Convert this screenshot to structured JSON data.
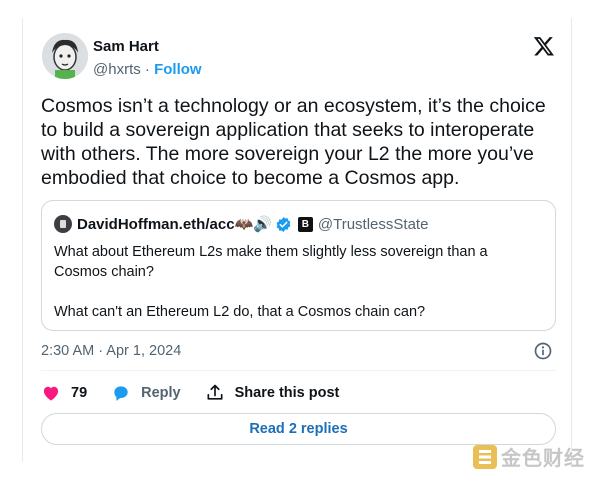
{
  "author": {
    "name": "Sam Hart",
    "handle": "@hxrts",
    "separator": "·",
    "follow_label": "Follow"
  },
  "tweet": {
    "text": "Cosmos isn’t a technology or an ecosystem, it’s the choice to build a sovereign application that seeks to interoperate with others. The more sovereign your L2 the more you’ve embodied that choice to become a Cosmos app."
  },
  "quoted": {
    "name": "DavidHoffman.eth/acc🦇🔊",
    "badge": "B",
    "handle": "@TrustlessState",
    "paragraphs": [
      "What about Ethereum L2s make them slightly less sovereign than a Cosmos chain?",
      "What can't an Ethereum L2 do, that a Cosmos chain can?"
    ]
  },
  "timestamp": "2:30 AM · Apr 1, 2024",
  "actions": {
    "like_count": "79",
    "reply_label": "Reply",
    "share_label": "Share this post"
  },
  "read_replies_label": "Read 2 replies",
  "watermark": {
    "text": "金色财经"
  },
  "colors": {
    "follow": "#1d9bf0",
    "verified": "#1d9bf0",
    "like": "#f91880",
    "reply": "#1d9bf0",
    "watermark_logo": "#e8b53a"
  },
  "icons": [
    "x-logo-icon",
    "heart-icon",
    "reply-bubble-icon",
    "share-icon",
    "info-icon",
    "verified-badge-icon"
  ]
}
